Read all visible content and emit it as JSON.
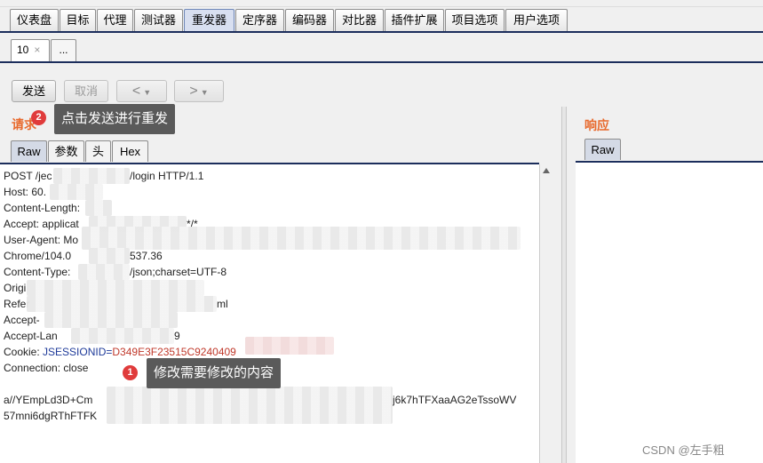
{
  "main_tabs": [
    "仪表盘",
    "目标",
    "代理",
    "测试器",
    "重发器",
    "定序器",
    "编码器",
    "对比器",
    "插件扩展",
    "项目选项",
    "用户选项"
  ],
  "sub_tabs": {
    "active": "10",
    "close": "×",
    "more": "..."
  },
  "toolbar": {
    "send": "发送",
    "cancel": "取消",
    "prev": "<",
    "next": ">",
    "drop": "▼"
  },
  "request": {
    "title": "请求",
    "tabs": [
      "Raw",
      "参数",
      "头",
      "Hex"
    ],
    "lines": [
      "POST /jec",
      "/login HTTP/1.1",
      "Host: 60.",
      "Content-Length:",
      "Accept: applicat",
      "*/*",
      "User-Agent: Mo",
      "Chrome/104.0",
      "537.36",
      "Content-Type:",
      "/json;charset=UTF-8",
      "Origi",
      "Refer",
      "ml",
      "Accept-",
      "Accept-Lan",
      "9",
      "Cookie: ",
      "JSESSIONID=",
      "D349E3F23515C9240409",
      "Connection: close",
      "a//YEmpLd3D+Cm",
      "j6k7hTFXaaAG2eTssoWV",
      "57mni6dgRThFTFK"
    ]
  },
  "response": {
    "title": "响应",
    "tabs": [
      "Raw"
    ]
  },
  "annotations": [
    {
      "number": "2",
      "text": "点击发送进行重发"
    },
    {
      "number": "1",
      "text": "修改需要修改的内容"
    }
  ],
  "watermark": "CSDN @左手粗"
}
